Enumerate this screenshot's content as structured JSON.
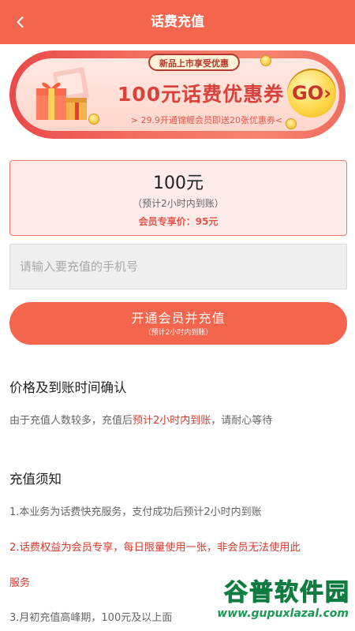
{
  "appbar": {
    "title": "话费充值",
    "back_icon": "chevron-left-icon",
    "color": "#f4654e"
  },
  "banner": {
    "tag": "新品上市享受优惠",
    "main": "100元话费优惠券",
    "sub": "> 29.9开通锦鲤会员即送20张优惠券<",
    "go_label": "GO›"
  },
  "price_card": {
    "amount": "100元",
    "note": "（预计2小时内到账）",
    "member_price": "会员专享价：95元"
  },
  "phone": {
    "placeholder": "请输入要充值的手机号",
    "value": ""
  },
  "submit": {
    "main": "开通会员并充值",
    "sub": "（预计2小时内到账）"
  },
  "section_price": {
    "title": "价格及到账时间确认",
    "text_before": "由于充值人数较多，充值后",
    "text_highlight": "预计2小时内到账",
    "text_after": "，请耐心等待"
  },
  "section_notice": {
    "title": "充值须知",
    "item1": "1.本业务为话费快充服务，支付成功后预计2小时内到账",
    "item2_line1": "2.话费权益为会员专享，每日限量使用一张，非会员无法使用此",
    "item2_line2": "服务",
    "item3": "3.月初充值高峰期，100元及以上面"
  },
  "watermark": {
    "logo": "谷普软件园",
    "url": "www.gupuxlazal.com"
  }
}
